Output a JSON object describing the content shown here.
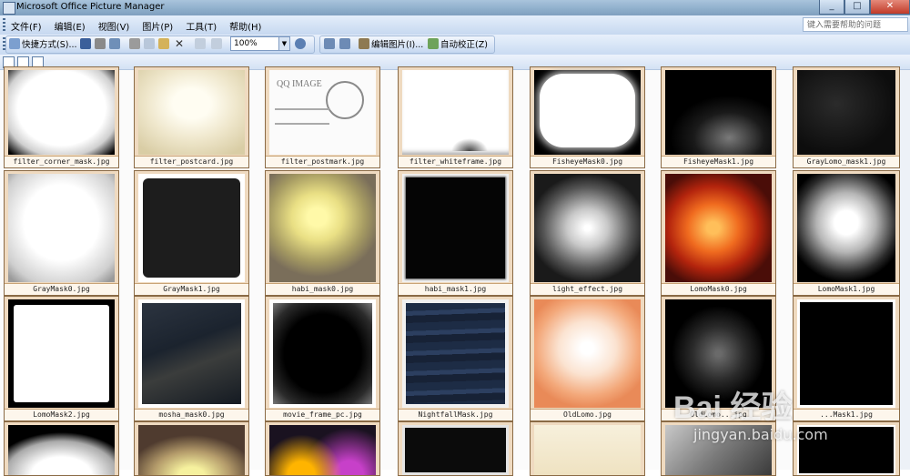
{
  "window": {
    "title": "Microsoft Office Picture Manager"
  },
  "menu": [
    "文件(F)",
    "编辑(E)",
    "视图(V)",
    "图片(P)",
    "工具(T)",
    "帮助(H)"
  ],
  "help_box": {
    "placeholder": "键入需要帮助的问题"
  },
  "toolbar": {
    "shortcuts": "快捷方式(S)...",
    "zoom": "100%",
    "edit_pictures": "编辑图片(I)...",
    "auto_correct": "自动校正(Z)"
  },
  "thumbnails": [
    "filter_corner_mask.jpg",
    "filter_postcard.jpg",
    "filter_postmark.jpg",
    "filter_whiteframe.jpg",
    "FisheyeMask0.jpg",
    "FisheyeMask1.jpg",
    "GrayLomo_mask1.jpg",
    "GrayMask0.jpg",
    "GrayMask1.jpg",
    "habi_mask0.jpg",
    "habi_mask1.jpg",
    "light_effect.jpg",
    "LomoMask0.jpg",
    "LomoMask1.jpg",
    "LomoMask2.jpg",
    "mosha_mask0.jpg",
    "movie_frame_pc.jpg",
    "NightfallMask.jpg",
    "OldLomo.jpg",
    "OldLomo...jpg",
    "...Mask1.jpg"
  ],
  "postmark_text": "QQ IMAGE",
  "watermark": {
    "brand": "Bai 经验",
    "url": "jingyan.baidu.com"
  }
}
